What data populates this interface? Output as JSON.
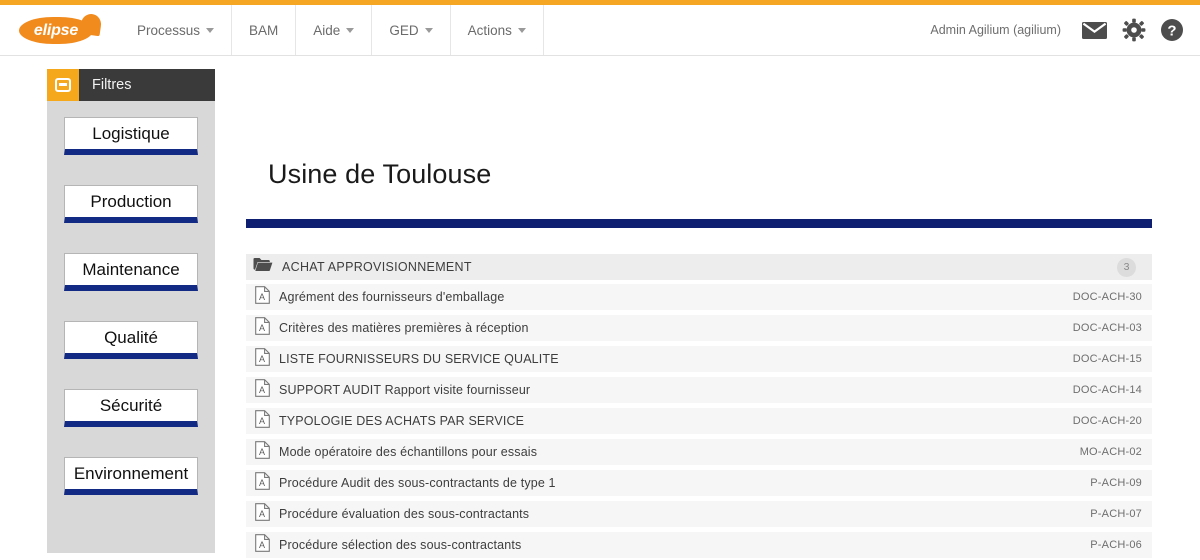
{
  "header": {
    "logo_text": "elipse",
    "nav": [
      {
        "label": "Processus",
        "has_caret": true
      },
      {
        "label": "BAM",
        "has_caret": false
      },
      {
        "label": "Aide",
        "has_caret": true
      },
      {
        "label": "GED",
        "has_caret": true
      },
      {
        "label": "Actions",
        "has_caret": true
      }
    ],
    "user": "Admin Agilium (agilium)",
    "icons": [
      "mail-icon",
      "gear-icon",
      "help-icon"
    ]
  },
  "sidebar": {
    "title": "Filtres",
    "icon": "filter-panel-icon",
    "items": [
      {
        "label": "Logistique"
      },
      {
        "label": "Production"
      },
      {
        "label": "Maintenance"
      },
      {
        "label": "Qualité"
      },
      {
        "label": "Sécurité"
      },
      {
        "label": "Environnement"
      }
    ]
  },
  "main": {
    "page_title": "Usine de Toulouse",
    "folder": {
      "name": "ACHAT APPROVISIONNEMENT",
      "count": "3",
      "icon": "folder-icon"
    },
    "documents": [
      {
        "name": "Agrément des fournisseurs d'emballage",
        "code": "DOC-ACH-30"
      },
      {
        "name": "Critères des matières premières à réception",
        "code": "DOC-ACH-03"
      },
      {
        "name": "LISTE FOURNISSEURS DU SERVICE QUALITE",
        "code": "DOC-ACH-15"
      },
      {
        "name": "SUPPORT AUDIT Rapport visite fournisseur",
        "code": "DOC-ACH-14"
      },
      {
        "name": "TYPOLOGIE DES ACHATS PAR SERVICE",
        "code": "DOC-ACH-20"
      },
      {
        "name": "Mode opératoire des échantillons pour essais",
        "code": "MO-ACH-02"
      },
      {
        "name": "Procédure Audit des sous-contractants de type 1",
        "code": "P-ACH-09"
      },
      {
        "name": "Procédure évaluation des sous-contractants",
        "code": "P-ACH-07"
      },
      {
        "name": "Procédure sélection des sous-contractants",
        "code": "P-ACH-06"
      }
    ]
  },
  "colors": {
    "accent_orange": "#f5a623",
    "logo_orange": "#f28b1e",
    "navy": "#0e1f71",
    "sidebar_gray": "#d8d8d8",
    "filters_bar": "#3a3a3a"
  }
}
